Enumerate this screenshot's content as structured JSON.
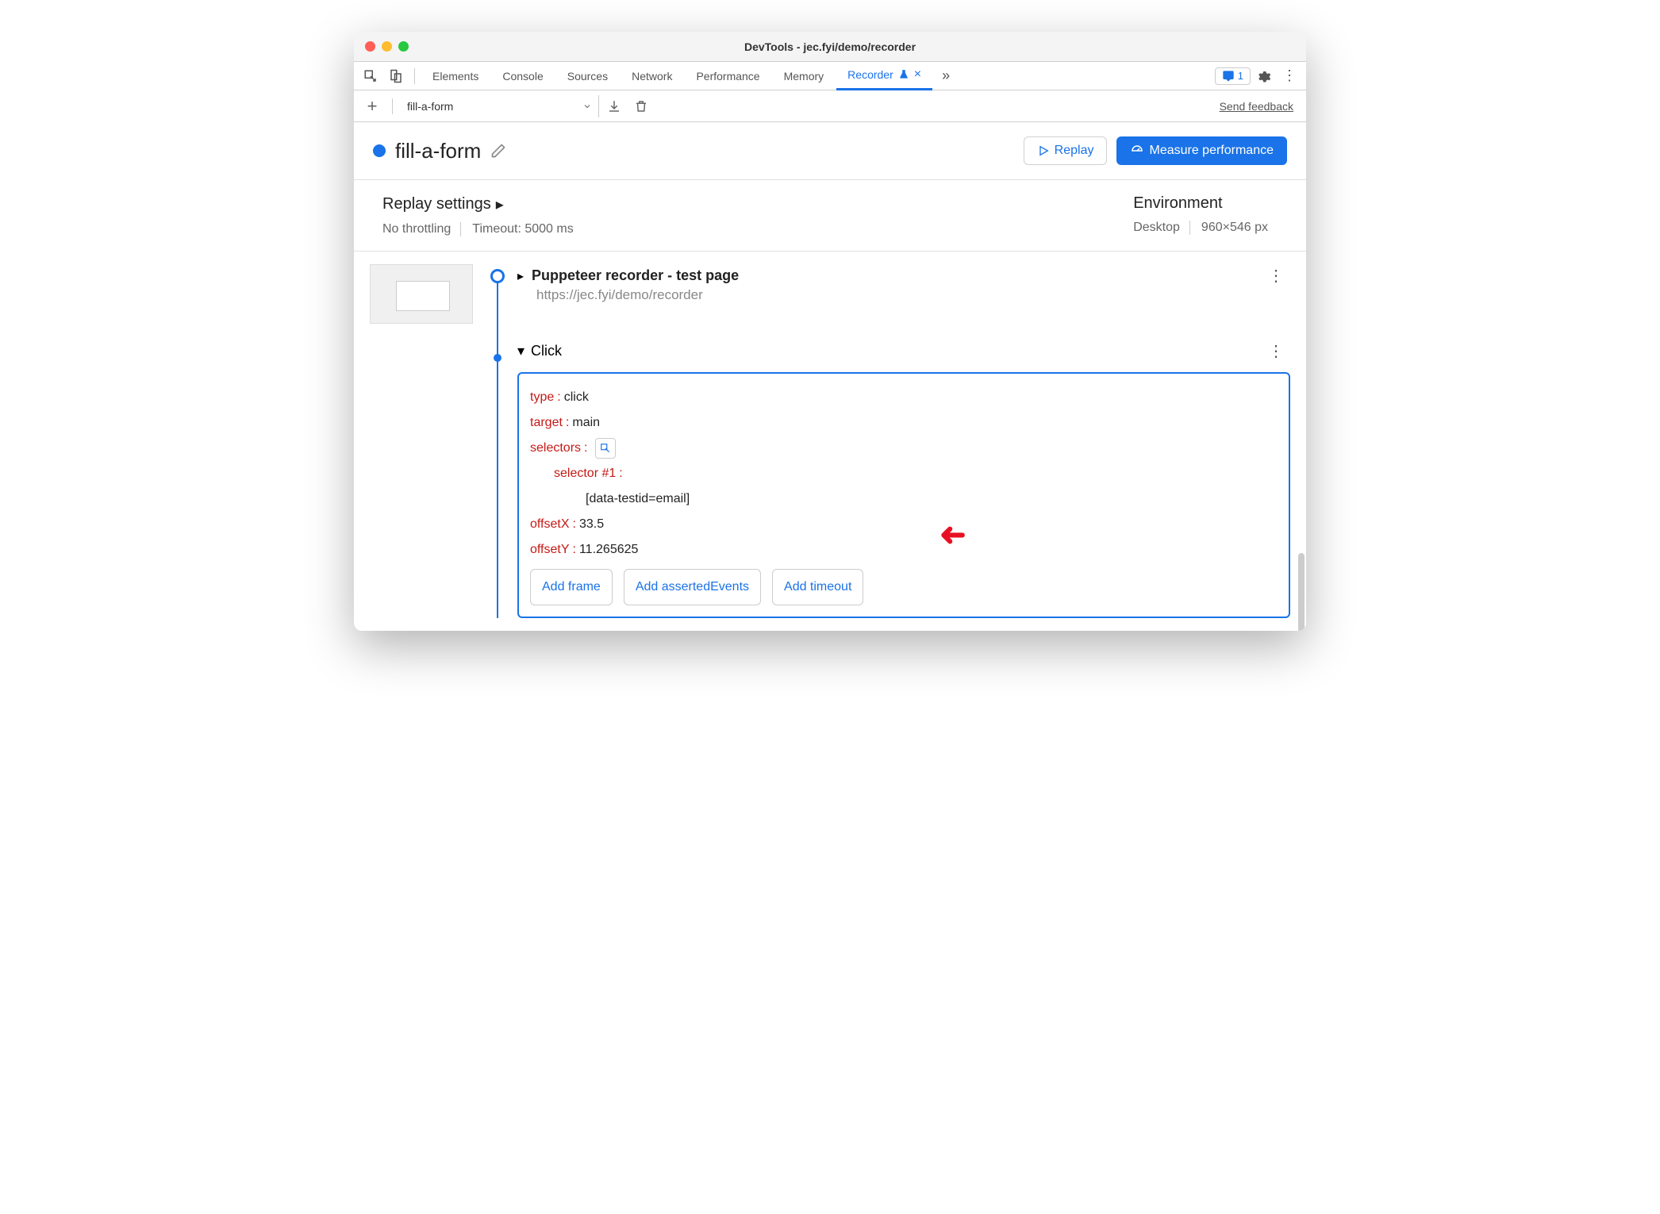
{
  "window": {
    "title": "DevTools - jec.fyi/demo/recorder"
  },
  "tabs": {
    "items": [
      "Elements",
      "Console",
      "Sources",
      "Network",
      "Performance",
      "Memory",
      "Recorder"
    ],
    "issues_count": "1"
  },
  "toolbar": {
    "recording_name": "fill-a-form",
    "feedback": "Send feedback"
  },
  "header": {
    "title": "fill-a-form",
    "replay_btn": "Replay",
    "measure_btn": "Measure performance"
  },
  "settings": {
    "replay_heading": "Replay settings",
    "throttling": "No throttling",
    "timeout": "Timeout: 5000 ms",
    "env_heading": "Environment",
    "device": "Desktop",
    "dimensions": "960×546 px"
  },
  "steps": {
    "navigation": {
      "title": "Puppeteer recorder - test page",
      "url": "https://jec.fyi/demo/recorder"
    },
    "click": {
      "label": "Click",
      "type_key": "type",
      "type_val": "click",
      "target_key": "target",
      "target_val": "main",
      "selectors_key": "selectors",
      "selector_label": "selector #1",
      "selector_val": "[data-testid=email]",
      "offsetx_key": "offsetX",
      "offsetx_val": "33.5",
      "offsety_key": "offsetY",
      "offsety_val": "11.265625",
      "add_frame": "Add frame",
      "add_asserted": "Add assertedEvents",
      "add_timeout": "Add timeout"
    }
  }
}
